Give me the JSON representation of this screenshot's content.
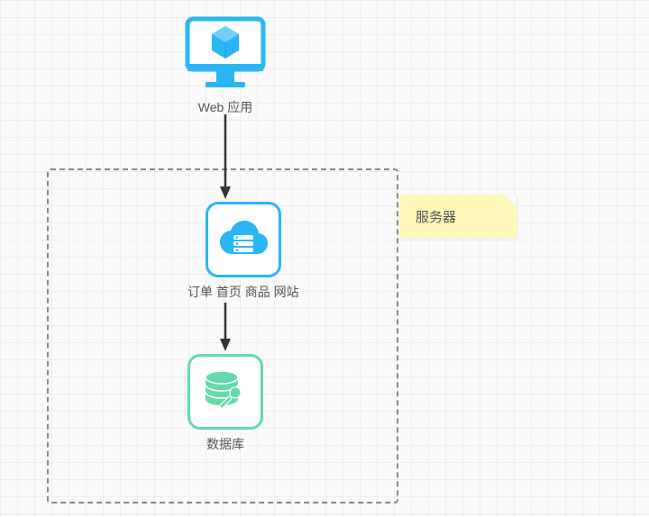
{
  "nodes": {
    "web_app": {
      "label": "Web 应用"
    },
    "services": {
      "label": "订单 首页 商品 网站"
    },
    "database": {
      "label": "数据库"
    }
  },
  "container": {
    "label": "服务器"
  },
  "colors": {
    "blue": "#29b6f6",
    "green": "#66d9a8",
    "note_bg": "#fdf8b8"
  }
}
